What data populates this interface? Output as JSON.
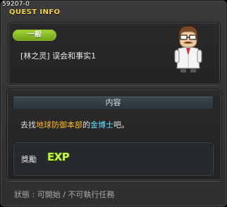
{
  "window": {
    "quest_id": "59207-0",
    "title": "QUEST INFO"
  },
  "quest": {
    "category": "一般",
    "name": "[林之灵] 误会和事实1"
  },
  "content": {
    "header": "内容",
    "text_before": "去找",
    "location": "地球防御本部",
    "text_mid": "的",
    "npc": "金博士",
    "text_after": "吧。"
  },
  "reward": {
    "label": "獎勵",
    "icon": "EXP"
  },
  "status": {
    "text": "狀態 : 可開始 / 不可執行任務"
  },
  "colors": {
    "title": "#f3d04a",
    "badge": "#8fbb2a",
    "location_highlight": "#ffb82a",
    "npc_highlight": "#5ee0ff",
    "exp": "#c8f24a"
  }
}
